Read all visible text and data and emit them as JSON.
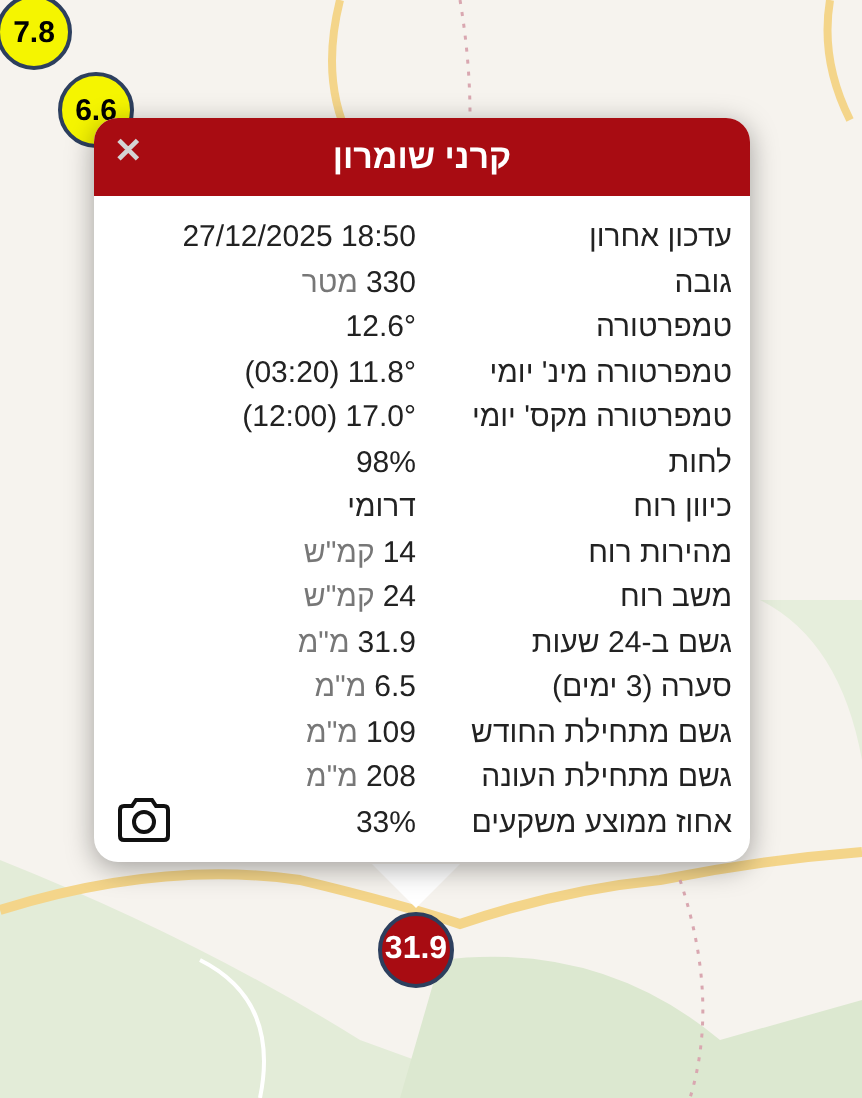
{
  "markers": [
    {
      "value": "7.8",
      "color": "#f5f500"
    },
    {
      "value": "6.6",
      "color": "#f5f500"
    },
    {
      "value": "31.9",
      "color": "#a80c12"
    }
  ],
  "popup": {
    "title": "קרני שומרון",
    "close": "✕",
    "rows": [
      {
        "label": "עדכון אחרון",
        "value": "27/12/2025 18:50"
      },
      {
        "label": "גובה",
        "value": "330",
        "unit": "מטר"
      },
      {
        "label": "טמפרטורה",
        "value": "12.6°"
      },
      {
        "label": "טמפרטורה מינ' יומי",
        "value": "(03:20) 11.8°"
      },
      {
        "label": "טמפרטורה מקס' יומי",
        "value": "(12:00) 17.0°"
      },
      {
        "label": "לחות",
        "value": "98%"
      },
      {
        "label": "כיוון רוח",
        "value": "דרומי"
      },
      {
        "label": "מהירות רוח",
        "value": "14",
        "unit": "קמ\"ש"
      },
      {
        "label": "משב רוח",
        "value": "24",
        "unit": "קמ\"ש"
      },
      {
        "label": "גשם ב-24 שעות",
        "value": "31.9",
        "unit": "מ\"מ"
      },
      {
        "label": "סערה (3 ימים)",
        "value": "6.5",
        "unit": "מ\"מ"
      },
      {
        "label": "גשם מתחילת החודש",
        "value": "109",
        "unit": "מ\"מ"
      },
      {
        "label": "גשם מתחילת העונה",
        "value": "208",
        "unit": "מ\"מ"
      },
      {
        "label": "אחוז ממוצע משקעים",
        "value": "33%"
      }
    ]
  }
}
